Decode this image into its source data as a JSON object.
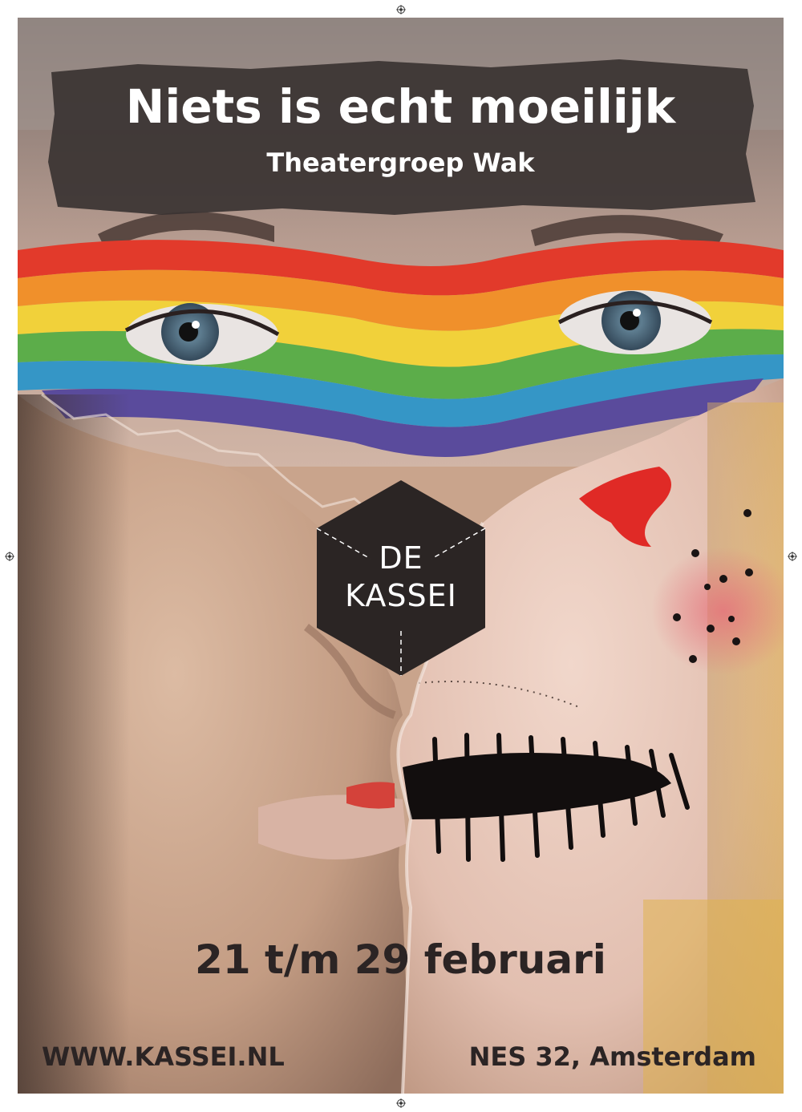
{
  "poster": {
    "title": "Niets is echt moeilijk",
    "subtitle": "Theatergroep Wak",
    "logo": {
      "line1": "DE",
      "line2": "KASSEI"
    },
    "dates": "21 t/m 29 februari",
    "website": "WWW.KASSEI.NL",
    "address": "NES 32, Amsterdam"
  },
  "colors": {
    "banner": "#3a3332",
    "logo": "#2b2524",
    "text_dark": "#2b2424",
    "text_light": "#ffffff",
    "skin_left": "#cba58c",
    "skin_right": "#e7c6b8",
    "rainbow": [
      "#e5432a",
      "#f2932a",
      "#f1d23b",
      "#63b24a",
      "#3a9bc8",
      "#5b4ea0"
    ]
  },
  "icons": {
    "registration": "crosshair-registration-mark"
  }
}
